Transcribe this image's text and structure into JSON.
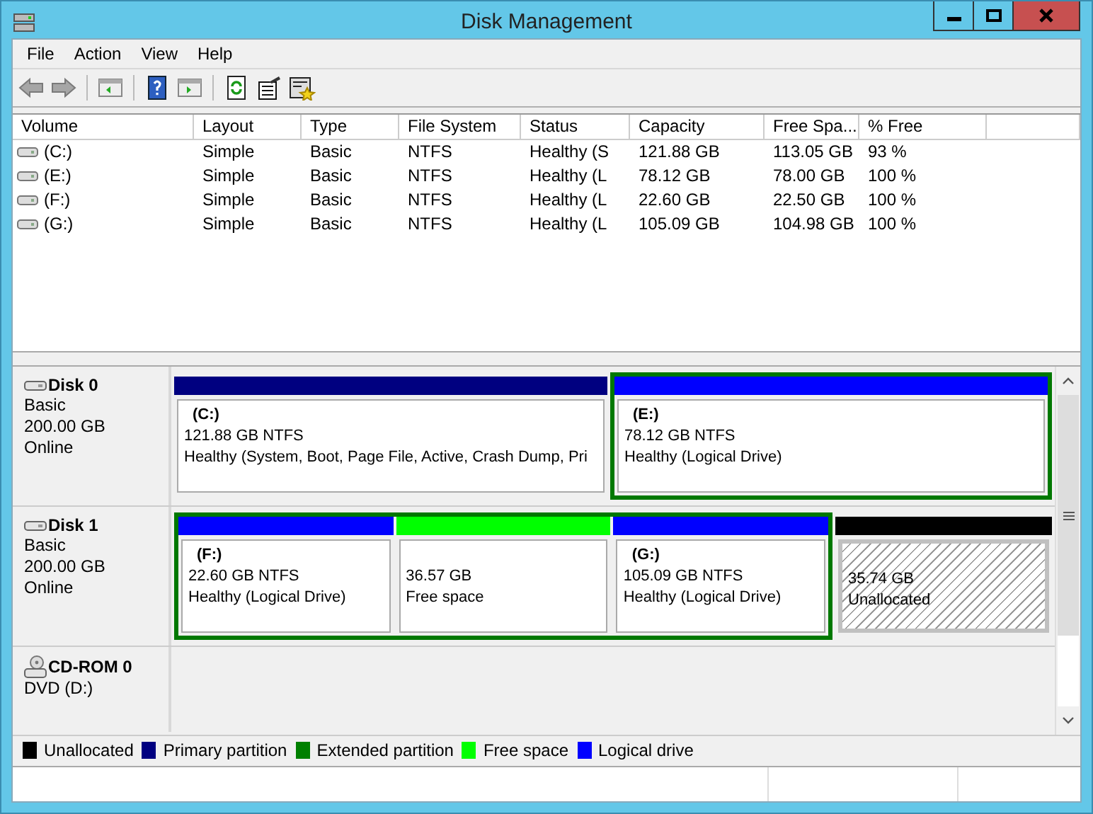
{
  "window": {
    "title": "Disk Management"
  },
  "menu": [
    "File",
    "Action",
    "View",
    "Help"
  ],
  "toolbar": [
    [
      {
        "kind": "back",
        "disabled": true
      },
      {
        "kind": "forward",
        "disabled": true
      }
    ],
    [
      {
        "kind": "tree",
        "disabled": false
      }
    ],
    [
      {
        "kind": "help",
        "disabled": false
      },
      {
        "kind": "pane",
        "disabled": false
      }
    ],
    [
      {
        "kind": "refresh",
        "disabled": false
      },
      {
        "kind": "properties",
        "disabled": false
      },
      {
        "kind": "wizard",
        "disabled": false
      }
    ]
  ],
  "volumes": {
    "columns": [
      "Volume",
      "Layout",
      "Type",
      "File System",
      "Status",
      "Capacity",
      "Free Spa...",
      "% Free"
    ],
    "rows": [
      [
        "(C:)",
        "Simple",
        "Basic",
        "NTFS",
        "Healthy (S",
        "121.88 GB",
        "113.05 GB",
        "93 %"
      ],
      [
        "(E:)",
        "Simple",
        "Basic",
        "NTFS",
        "Healthy (L",
        "78.12 GB",
        "78.00 GB",
        "100 %"
      ],
      [
        "(F:)",
        "Simple",
        "Basic",
        "NTFS",
        "Healthy (L",
        "22.60 GB",
        "22.50 GB",
        "100 %"
      ],
      [
        "(G:)",
        "Simple",
        "Basic",
        "NTFS",
        "Healthy (L",
        "105.09 GB",
        "104.98 GB",
        "100 %"
      ]
    ]
  },
  "disks": [
    {
      "kind": "disk",
      "name": "Disk 0",
      "lines": [
        "Basic",
        "200.00 GB",
        "Online"
      ],
      "partitions": [
        {
          "kind": "primary",
          "label": "(C:)",
          "size": "121.88 GB NTFS",
          "status": "Healthy (System, Boot, Page File, Active, Crash Dump, Pri"
        },
        {
          "kind": "extended",
          "children": [
            {
              "kind": "logical",
              "label": "(E:)",
              "size": "78.12 GB NTFS",
              "status": "Healthy (Logical Drive)"
            }
          ]
        }
      ]
    },
    {
      "kind": "disk",
      "name": "Disk 1",
      "lines": [
        "Basic",
        "200.00 GB",
        "Online"
      ],
      "partitions": [
        {
          "kind": "extended",
          "children": [
            {
              "kind": "logical",
              "label": "(F:)",
              "size": "22.60 GB NTFS",
              "status": "Healthy (Logical Drive)"
            },
            {
              "kind": "free",
              "size": "36.57 GB",
              "status": "Free space"
            },
            {
              "kind": "logical",
              "label": "(G:)",
              "size": "105.09 GB NTFS",
              "status": "Healthy (Logical Drive)"
            }
          ]
        },
        {
          "kind": "unallocated",
          "size": "35.74 GB",
          "status": "Unallocated"
        }
      ]
    },
    {
      "kind": "cdrom",
      "name": "CD-ROM 0",
      "lines": [
        "DVD (D:)"
      ]
    }
  ],
  "legend": [
    {
      "label": "Unallocated",
      "color": "#000000"
    },
    {
      "label": "Primary partition",
      "color": "#000080"
    },
    {
      "label": "Extended partition",
      "color": "#008000"
    },
    {
      "label": "Free space",
      "color": "#00ff00"
    },
    {
      "label": "Logical drive",
      "color": "#0000ff"
    }
  ]
}
